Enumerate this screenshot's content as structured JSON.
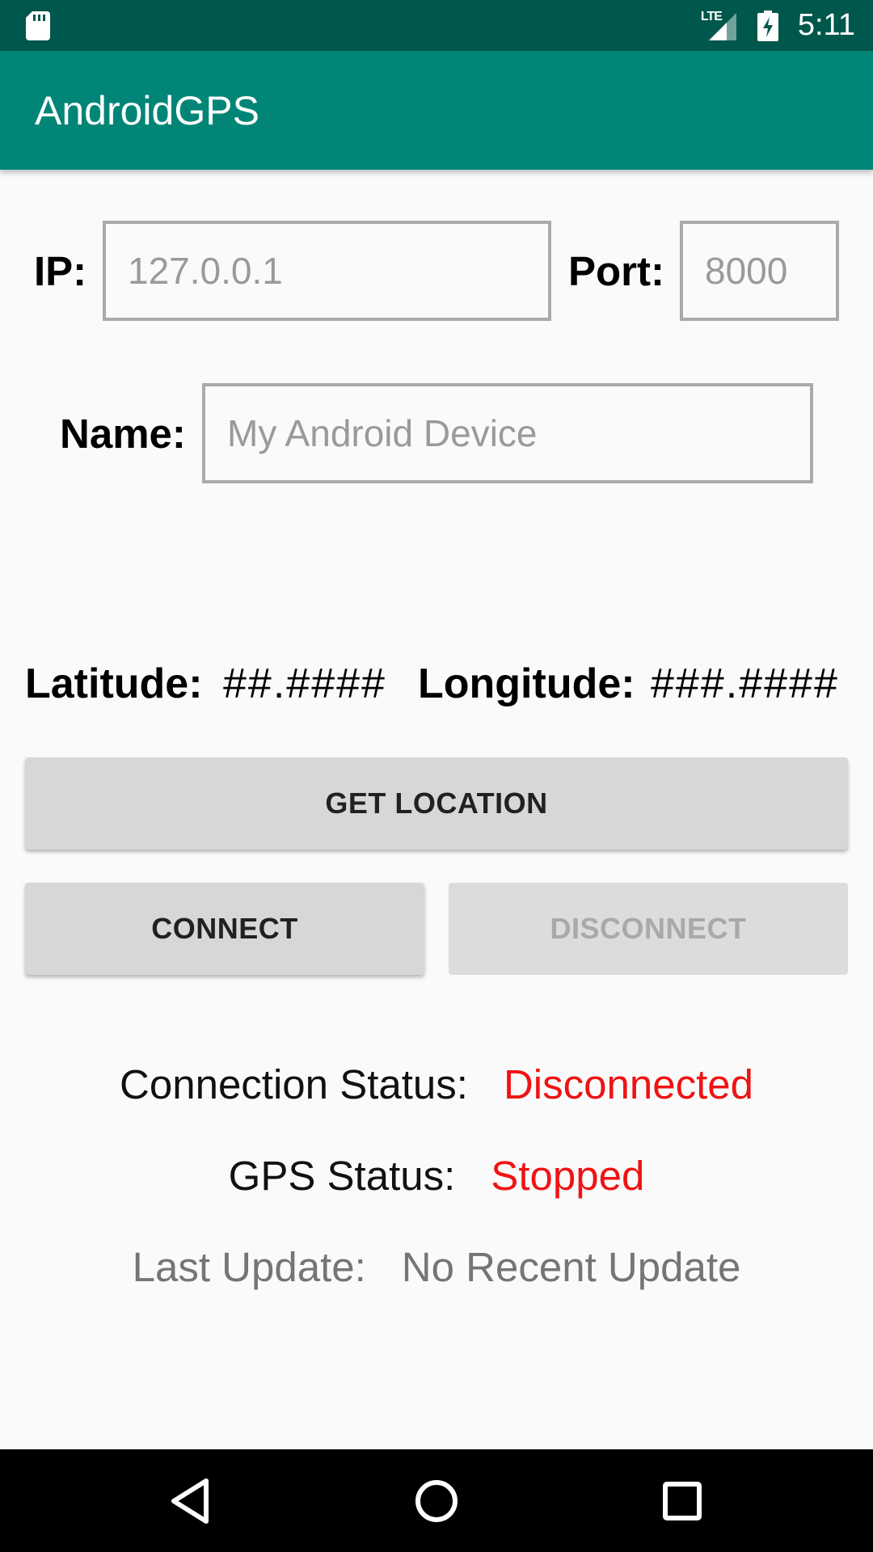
{
  "status_bar": {
    "network": "LTE",
    "time": "5:11",
    "icons": [
      "sd-card-icon",
      "signal-icon",
      "battery-charging-icon"
    ]
  },
  "app_bar": {
    "title": "AndroidGPS"
  },
  "form": {
    "ip_label": "IP:",
    "ip_placeholder": "127.0.0.1",
    "port_label": "Port:",
    "port_placeholder": "8000",
    "name_label": "Name:",
    "name_placeholder": "My Android Device"
  },
  "location": {
    "latitude_label": "Latitude:",
    "latitude_value": "##.####",
    "longitude_label": "Longitude:",
    "longitude_value": "###.####"
  },
  "buttons": {
    "get_location": "GET LOCATION",
    "connect": "CONNECT",
    "disconnect": "DISCONNECT"
  },
  "status": {
    "connection_label": "Connection Status:",
    "connection_value": "Disconnected",
    "gps_label": "GPS Status:",
    "gps_value": "Stopped",
    "last_update_label": "Last Update:",
    "last_update_value": "No Recent Update"
  },
  "colors": {
    "status_bar": "#00574b",
    "app_bar": "#008577",
    "status_red": "#ef1313"
  },
  "nav_bar": {
    "icons": [
      "back-icon",
      "home-icon",
      "recents-icon"
    ]
  }
}
